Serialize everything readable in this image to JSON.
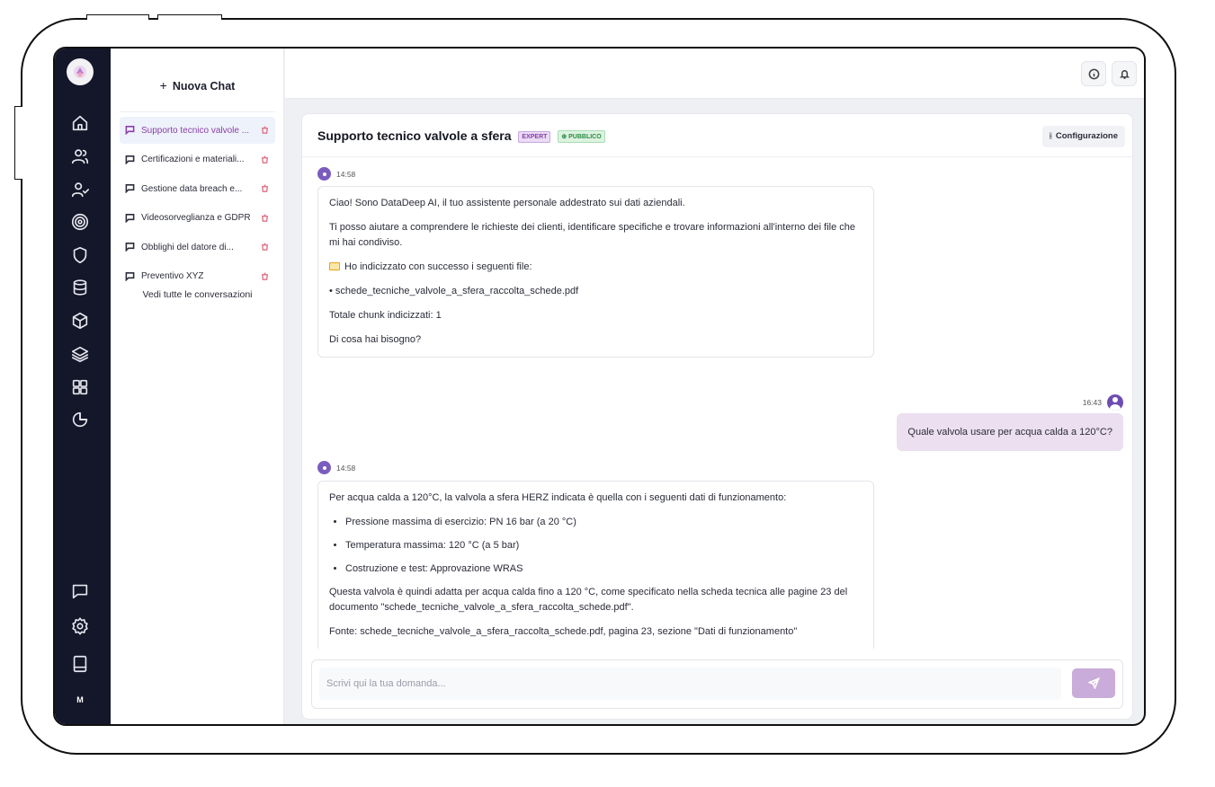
{
  "sidebar": {
    "new_chat_label": "Nuova Chat",
    "conversations": [
      {
        "label": "Supporto tecnico valvole ...",
        "active": true
      },
      {
        "label": "Certificazioni e materiali..."
      },
      {
        "label": "Gestione data breach e..."
      },
      {
        "label": "Videosorveglianza e GDPR"
      },
      {
        "label": "Obblighi del datore di..."
      },
      {
        "label": "Preventivo XYZ"
      }
    ],
    "see_all_label": "Vedi tutte le conversazioni"
  },
  "rail": {
    "icons": [
      "home-icon",
      "users-icon",
      "user-check-icon",
      "target-icon",
      "shield-icon",
      "database-icon",
      "box-icon",
      "layers-icon",
      "grid-icon",
      "pie-chart-icon"
    ],
    "bottom_icons": [
      "chat-icon",
      "settings-icon",
      "tablet-icon"
    ],
    "avatar_initial": "M"
  },
  "topbar": {
    "icons": [
      "info-icon",
      "bell-icon"
    ]
  },
  "chat": {
    "title": "Supporto tecnico valvole a sfera",
    "badge_expert": "EXPERT",
    "badge_public": "⊕ PUBBLICO",
    "config_label": "Configurazione",
    "messages": {
      "bot1": {
        "time": "14:58",
        "p1": "Ciao! Sono DataDeep AI, il tuo assistente personale addestrato sui dati aziendali.",
        "p2": "Ti posso aiutare a comprendere le richieste dei clienti, identificare specifiche e trovare informazioni all'interno dei file che mi hai condiviso.",
        "p3": "Ho indicizzato con successo i seguenti file:",
        "p4": "• schede_tecniche_valvole_a_sfera_raccolta_schede.pdf",
        "p5": "Totale chunk indicizzati: 1",
        "p6": "Di cosa hai bisogno?"
      },
      "user1": {
        "time": "16:43",
        "text": "Quale valvola usare per acqua calda a 120°C?"
      },
      "bot2": {
        "time": "14:58",
        "p1": "Per acqua calda a 120°C, la valvola a sfera HERZ indicata è quella con i seguenti dati di funzionamento:",
        "bullets": [
          "Pressione massima di esercizio: PN 16 bar (a 20 °C)",
          "Temperatura massima: 120 °C (a 5 bar)",
          "Costruzione e test: Approvazione WRAS"
        ],
        "p2": "Questa valvola è quindi adatta per acqua calda fino a 120 °C, come specificato nella scheda tecnica alle pagine 23 del documento \"schede_tecniche_valvole_a_sfera_raccolta_schede.pdf\".",
        "p3": "Fonte: schede_tecniche_valvole_a_sfera_raccolta_schede.pdf, pagina 23, sezione \"Dati di funzionamento\""
      }
    },
    "input_placeholder": "Scrivi qui la tua domanda..."
  }
}
